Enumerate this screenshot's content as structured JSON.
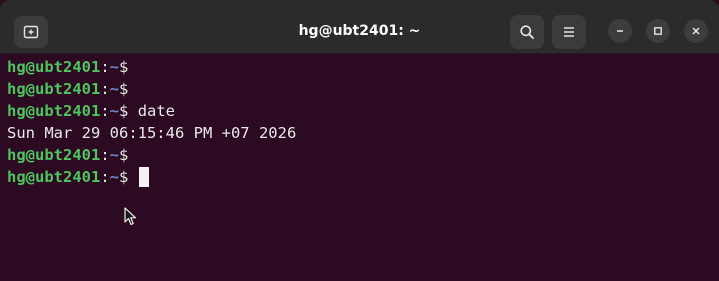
{
  "window": {
    "title": "hg@ubt2401: ~"
  },
  "titlebar": {
    "new_tab_icon": "new-tab-icon",
    "search_icon": "search-icon",
    "menu_icon": "hamburger-menu-icon",
    "minimize_icon": "minimize-icon",
    "maximize_icon": "maximize-icon",
    "close_icon": "close-icon"
  },
  "terminal": {
    "lines": [
      {
        "user": "hg@ubt2401",
        "sep": ":",
        "path": "~",
        "prompt": "$",
        "command": ""
      },
      {
        "user": "hg@ubt2401",
        "sep": ":",
        "path": "~",
        "prompt": "$",
        "command": ""
      },
      {
        "user": "hg@ubt2401",
        "sep": ":",
        "path": "~",
        "prompt": "$",
        "command": " date"
      },
      {
        "output": "Sun Mar 29 06:15:46 PM +07 2026"
      },
      {
        "user": "hg@ubt2401",
        "sep": ":",
        "path": "~",
        "prompt": "$",
        "command": ""
      },
      {
        "user": "hg@ubt2401",
        "sep": ":",
        "path": "~",
        "prompt": "$",
        "command": " "
      }
    ]
  },
  "colors": {
    "background": "#2c0a22",
    "user": "#4ec45e",
    "path": "#6b86c9",
    "titlebar": "#2b2b2b"
  }
}
